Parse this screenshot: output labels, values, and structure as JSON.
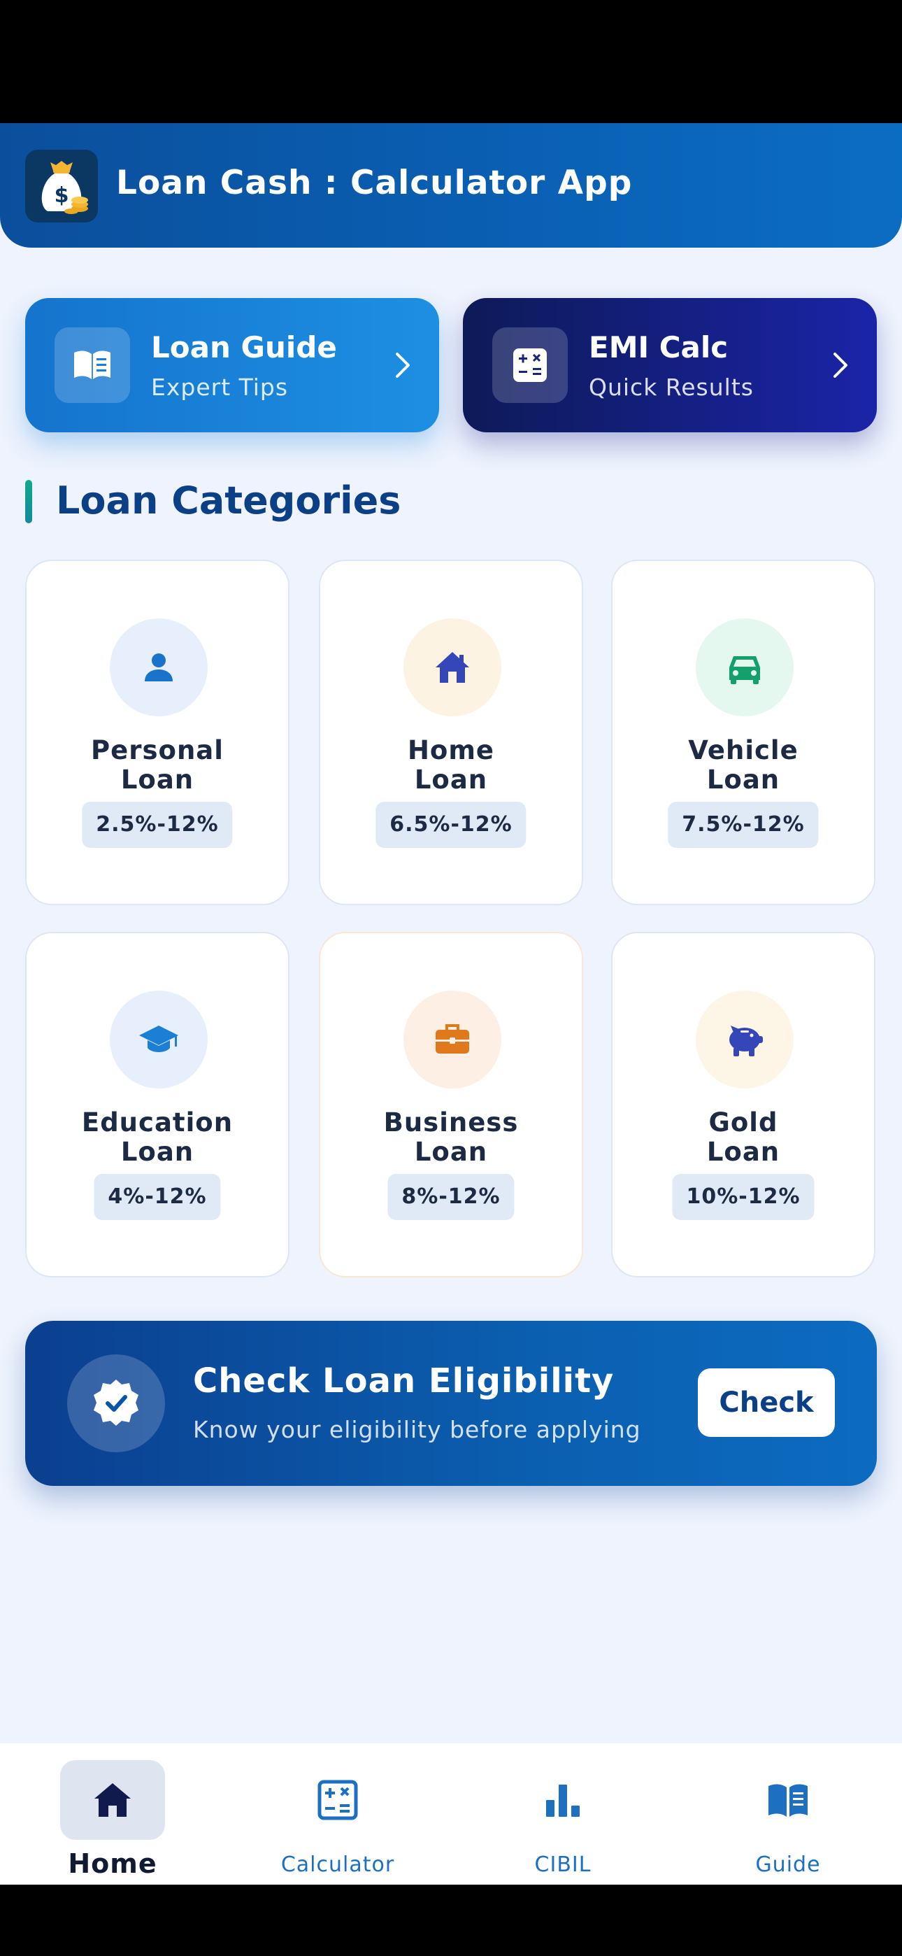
{
  "header": {
    "title": "Loan Cash : Calculator App",
    "icon": "money-bag-icon"
  },
  "quick_cards": [
    {
      "title": "Loan Guide",
      "subtitle": "Expert Tips",
      "icon": "book-icon"
    },
    {
      "title": "EMI Calc",
      "subtitle": "Quick Results",
      "icon": "calculator-icon"
    }
  ],
  "section": {
    "title": "Loan Categories"
  },
  "categories": [
    {
      "line1": "Personal",
      "line2": "Loan",
      "rate": "2.5%-12%",
      "icon": "person-icon",
      "icon_color": "#1a73c9",
      "icon_bg": "#e6effb"
    },
    {
      "line1": "Home",
      "line2": "Loan",
      "rate": "6.5%-12%",
      "icon": "house-icon",
      "icon_color": "#3446b8",
      "icon_bg": "#fdf3e3"
    },
    {
      "line1": "Vehicle",
      "line2": "Loan",
      "rate": "7.5%-12%",
      "icon": "car-icon",
      "icon_color": "#13a06c",
      "icon_bg": "#e4f8ef"
    },
    {
      "line1": "Education",
      "line2": "Loan",
      "rate": "4%-12%",
      "icon": "graduation-cap-icon",
      "icon_color": "#1b7fd6",
      "icon_bg": "#e6effb"
    },
    {
      "line1": "Business",
      "line2": "Loan",
      "rate": "8%-12%",
      "icon": "briefcase-icon",
      "icon_color": "#e0781c",
      "icon_bg": "#fdefe3"
    },
    {
      "line1": "Gold",
      "line2": "Loan",
      "rate": "10%-12%",
      "icon": "piggy-bank-icon",
      "icon_color": "#3446b8",
      "icon_bg": "#fdf6e6"
    }
  ],
  "eligibility": {
    "title": "Check Loan Eligibility",
    "subtitle": "Know your eligibility before applying",
    "button": "Check",
    "icon": "verified-badge-icon"
  },
  "bottom_nav": [
    {
      "label": "Home",
      "icon": "home-icon",
      "active": true
    },
    {
      "label": "Calculator",
      "icon": "calculator-icon",
      "active": false
    },
    {
      "label": "CIBIL",
      "icon": "bar-chart-icon",
      "active": false
    },
    {
      "label": "Guide",
      "icon": "book-icon",
      "active": false
    }
  ]
}
